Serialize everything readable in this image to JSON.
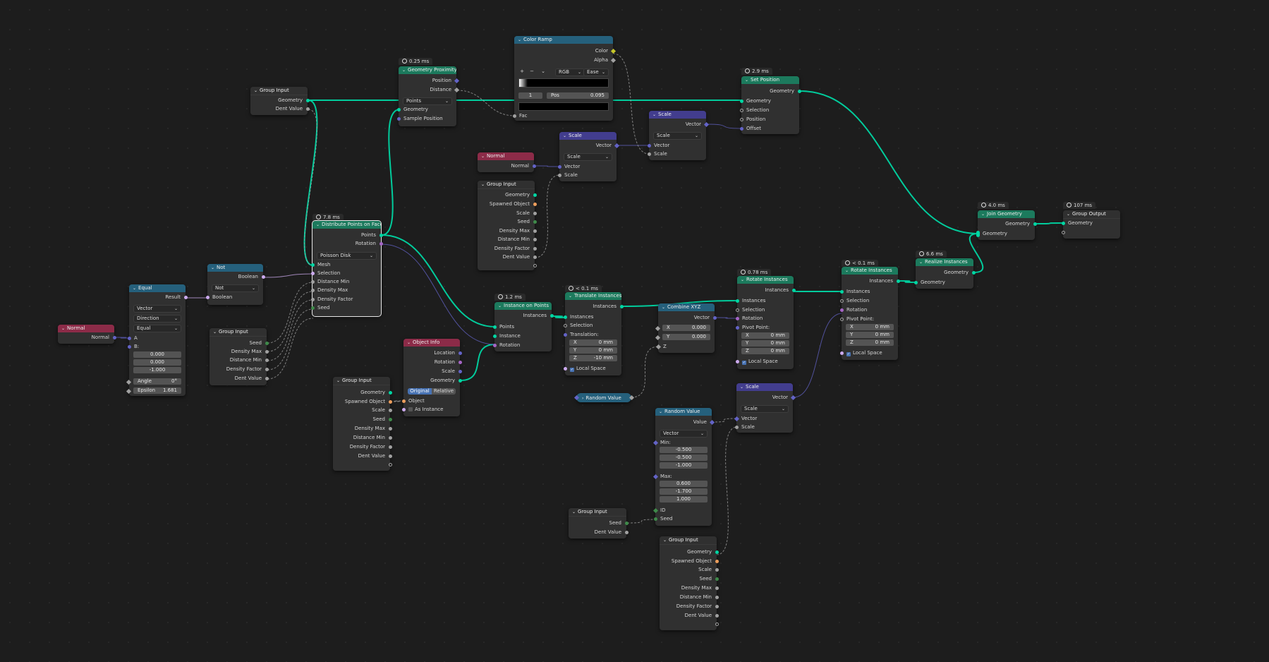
{
  "editor": {
    "name": "Geometry Node Editor"
  },
  "nodes": {
    "normal1": {
      "title": "Normal",
      "outputs": [
        "Normal"
      ]
    },
    "equal": {
      "title": "Equal",
      "outputs": [
        "Result"
      ],
      "dropdowns": [
        "Vector",
        "Direction",
        "Equal"
      ],
      "inputs": [
        "A",
        "B:"
      ],
      "b_values": [
        "0.000",
        "0.000",
        "-1.000"
      ],
      "angle_label": "Angle",
      "angle_value": "0°",
      "epsilon_label": "Epsilon",
      "epsilon_value": "1.681"
    },
    "not": {
      "title": "Not",
      "outputs": [
        "Boolean"
      ],
      "dropdown": "Not",
      "inputs": [
        "Boolean"
      ]
    },
    "group_input1": {
      "title": "Group Input",
      "outputs": [
        "Geometry",
        "Dent Value"
      ]
    },
    "group_input2": {
      "title": "Group Input",
      "outputs": [
        "Seed",
        "Density Max",
        "Distance Min",
        "Density Factor",
        "Dent Value"
      ]
    },
    "distribute": {
      "title": "Distribute Points on Faces",
      "timing": "7.8 ms",
      "outputs": [
        "Points",
        "Rotation"
      ],
      "dropdown": "Poisson Disk",
      "inputs": [
        "Mesh",
        "Selection",
        "Distance Min",
        "Density Max",
        "Density Factor",
        "Seed"
      ]
    },
    "geo_prox": {
      "title": "Geometry Proximity",
      "timing": "0.25 ms",
      "outputs": [
        "Position",
        "Distance"
      ],
      "dropdown": "Points",
      "inputs": [
        "Geometry",
        "Sample Position"
      ]
    },
    "color_ramp": {
      "title": "Color Ramp",
      "outputs": [
        "Color",
        "Alpha"
      ],
      "controls": {
        "add": "+",
        "remove": "−",
        "menu": "⌄",
        "mode": "RGB",
        "interp": "Ease"
      },
      "index": "1",
      "pos_label": "Pos",
      "pos_value": "0.095",
      "inputs": [
        "Fac"
      ]
    },
    "normal2": {
      "title": "Normal",
      "outputs": [
        "Normal"
      ]
    },
    "scale_mid": {
      "title": "Scale",
      "outputs": [
        "Vector"
      ],
      "dropdown": "Scale",
      "inputs": [
        "Vector",
        "Scale"
      ]
    },
    "group_input3": {
      "title": "Group Input",
      "outputs": [
        "Geometry",
        "Spawned Object",
        "Scale",
        "Seed",
        "Density Max",
        "Distance Min",
        "Density Factor",
        "Dent Value"
      ]
    },
    "scale_top": {
      "title": "Scale",
      "outputs": [
        "Vector"
      ],
      "dropdown": "Scale",
      "inputs": [
        "Vector",
        "Scale"
      ]
    },
    "set_position": {
      "title": "Set Position",
      "timing": "2.9 ms",
      "outputs": [
        "Geometry"
      ],
      "inputs": [
        "Geometry",
        "Selection",
        "Position",
        "Offset"
      ]
    },
    "group_input4": {
      "title": "Group Input",
      "outputs": [
        "Geometry",
        "Spawned Object",
        "Scale",
        "Seed",
        "Density Max",
        "Distance Min",
        "Density Factor",
        "Dent Value"
      ]
    },
    "object_info": {
      "title": "Object Info",
      "outputs": [
        "Location",
        "Rotation",
        "Scale",
        "Geometry"
      ],
      "seg": [
        "Original",
        "Relative"
      ],
      "inputs": [
        "Object",
        "As Instance"
      ]
    },
    "instance_on_points": {
      "title": "Instance on Points",
      "timing": "1.2 ms",
      "outputs": [
        "Instances"
      ],
      "inputs": [
        "Points",
        "Instance",
        "Rotation"
      ]
    },
    "translate": {
      "title": "Translate Instances",
      "timing": "< 0.1 ms",
      "outputs": [
        "Instances"
      ],
      "inputs": [
        "Instances",
        "Selection",
        "Translation:"
      ],
      "xyz": [
        [
          "X",
          "0 mm"
        ],
        [
          "Y",
          "0 mm"
        ],
        [
          "Z",
          "-10 mm"
        ]
      ],
      "local_space": "Local Space"
    },
    "random_value_reroute": {
      "title": "Random Value"
    },
    "combine_xyz": {
      "title": "Combine XYZ",
      "outputs": [
        "Vector"
      ],
      "fields": [
        [
          "X",
          "0.000"
        ],
        [
          "Y",
          "0.000"
        ]
      ],
      "inputs": [
        "Z"
      ]
    },
    "random_value": {
      "title": "Random Value",
      "outputs": [
        "Value"
      ],
      "dropdown": "Vector",
      "min_label": "Min:",
      "min_values": [
        "-0.500",
        "-0.500",
        "-1.000"
      ],
      "max_label": "Max:",
      "max_values": [
        "0.600",
        "-1.700",
        "1.000"
      ],
      "inputs": [
        "ID",
        "Seed"
      ]
    },
    "group_input5": {
      "title": "Group Input",
      "outputs": [
        "Seed",
        "Dent Value"
      ]
    },
    "group_input6": {
      "title": "Group Input",
      "outputs": [
        "Geometry",
        "Spawned Object",
        "Scale",
        "Seed",
        "Density Max",
        "Distance Min",
        "Density Factor",
        "Dent Value"
      ]
    },
    "scale_bottom": {
      "title": "Scale",
      "outputs": [
        "Vector"
      ],
      "dropdown": "Scale",
      "inputs": [
        "Vector",
        "Scale"
      ]
    },
    "rotate": {
      "title": "Rotate Instances",
      "timing": "0.78 ms",
      "outputs": [
        "Instances"
      ],
      "inputs": [
        "Instances",
        "Selection",
        "Rotation",
        "Pivot Point:"
      ],
      "xyz": [
        [
          "X",
          "0 mm"
        ],
        [
          "Y",
          "0 mm"
        ],
        [
          "Z",
          "0 mm"
        ]
      ],
      "local_space": "Local Space"
    },
    "rotate2": {
      "title": "Rotate Instances",
      "timing": "< 0.1 ms",
      "outputs": [
        "Instances"
      ],
      "inputs": [
        "Instances",
        "Selection",
        "Rotation",
        "Pivot Point:"
      ],
      "xyz": [
        [
          "X",
          "0 mm"
        ],
        [
          "Y",
          "0 mm"
        ],
        [
          "Z",
          "0 mm"
        ]
      ],
      "local_space": "Local Space"
    },
    "realize": {
      "title": "Realize Instances",
      "timing": "6.6 ms",
      "outputs": [
        "Geometry"
      ],
      "inputs": [
        "Geometry"
      ]
    },
    "join": {
      "title": "Join Geometry",
      "timing": "4.0 ms",
      "outputs": [
        "Geometry"
      ],
      "inputs": [
        "Geometry"
      ]
    },
    "group_output": {
      "title": "Group Output",
      "timing": "107 ms",
      "inputs": [
        "Geometry"
      ]
    }
  },
  "colors": {
    "geometry_wire": "#00d6a3",
    "vector_wire": "#6363c7",
    "float_wire": "#a1a1a1",
    "bool_wire": "#ccaaee"
  }
}
